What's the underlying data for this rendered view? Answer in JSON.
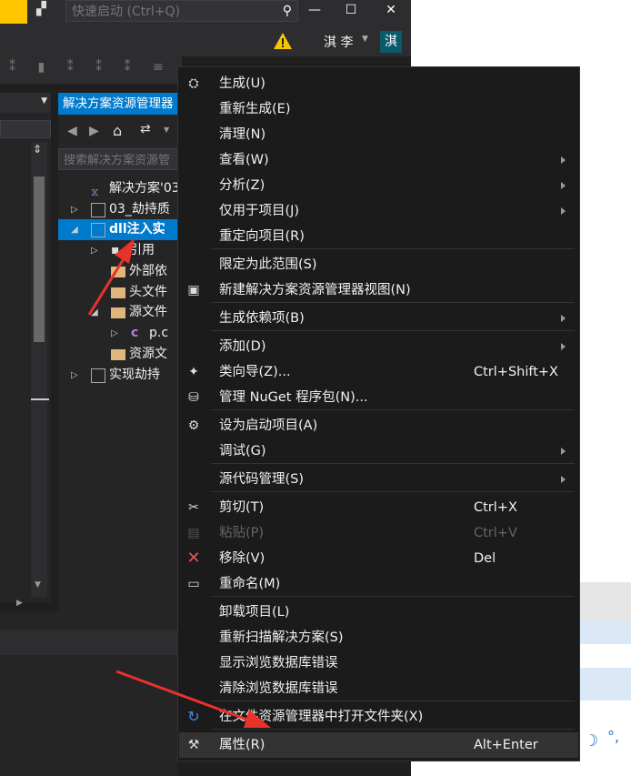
{
  "titlebar": {
    "quick_launch_placeholder": "快速启动 (Ctrl+Q)",
    "user_name": "淇 李",
    "avatar_initial": "淇"
  },
  "solution_explorer": {
    "title": "解决方案资源管理器",
    "search_placeholder": "搜索解决方案资源管",
    "tree": [
      {
        "label": "解决方案'03_",
        "indent": 0,
        "arrow": ""
      },
      {
        "label": "03_劫持质",
        "indent": 1,
        "arrow": "right"
      },
      {
        "label": "dll注入实",
        "indent": 1,
        "arrow": "down",
        "selected": true
      },
      {
        "label": "引用",
        "indent": 2,
        "arrow": "right"
      },
      {
        "label": "外部依",
        "indent": 2,
        "arrow": ""
      },
      {
        "label": "头文件",
        "indent": 2,
        "arrow": ""
      },
      {
        "label": "源文件",
        "indent": 2,
        "arrow": "down"
      },
      {
        "label": "p.c",
        "indent": 3,
        "arrow": "right"
      },
      {
        "label": "资源文",
        "indent": 2,
        "arrow": ""
      },
      {
        "label": "实现劫持",
        "indent": 1,
        "arrow": "right"
      }
    ]
  },
  "context_menu": {
    "items": [
      {
        "label": "生成(U)",
        "icon": "build-icon"
      },
      {
        "label": "重新生成(E)"
      },
      {
        "label": "清理(N)"
      },
      {
        "label": "查看(W)",
        "submenu": true
      },
      {
        "label": "分析(Z)",
        "submenu": true
      },
      {
        "label": "仅用于项目(J)",
        "submenu": true
      },
      {
        "label": "重定向项目(R)"
      },
      {
        "label": "限定为此范围(S)"
      },
      {
        "label": "新建解决方案资源管理器视图(N)",
        "icon": "new-view-icon"
      },
      {
        "label": "生成依赖项(B)",
        "submenu": true
      },
      {
        "label": "添加(D)",
        "submenu": true
      },
      {
        "label": "类向导(Z)...",
        "shortcut": "Ctrl+Shift+X",
        "icon": "class-wizard-icon"
      },
      {
        "label": "管理 NuGet 程序包(N)...",
        "icon": "nuget-icon"
      },
      {
        "label": "设为启动项目(A)",
        "icon": "gear-icon"
      },
      {
        "label": "调试(G)",
        "submenu": true
      },
      {
        "label": "源代码管理(S)",
        "submenu": true
      },
      {
        "label": "剪切(T)",
        "shortcut": "Ctrl+X",
        "icon": "cut-icon"
      },
      {
        "label": "粘贴(P)",
        "shortcut": "Ctrl+V",
        "icon": "paste-icon",
        "disabled": true
      },
      {
        "label": "移除(V)",
        "shortcut": "Del",
        "icon": "remove-icon"
      },
      {
        "label": "重命名(M)",
        "icon": "rename-icon"
      },
      {
        "label": "卸载项目(L)"
      },
      {
        "label": "重新扫描解决方案(S)"
      },
      {
        "label": "显示浏览数据库错误"
      },
      {
        "label": "清除浏览数据库错误"
      },
      {
        "label": "在文件资源管理器中打开文件夹(X)",
        "icon": "refresh-folder-icon"
      },
      {
        "label": "属性(R)",
        "shortcut": "Alt+Enter",
        "icon": "wrench-icon",
        "hover": true
      }
    ]
  },
  "colors": {
    "accent": "#007acc",
    "annotation_arrow": "#e8322a",
    "remove_icon": "#e05a4f"
  }
}
